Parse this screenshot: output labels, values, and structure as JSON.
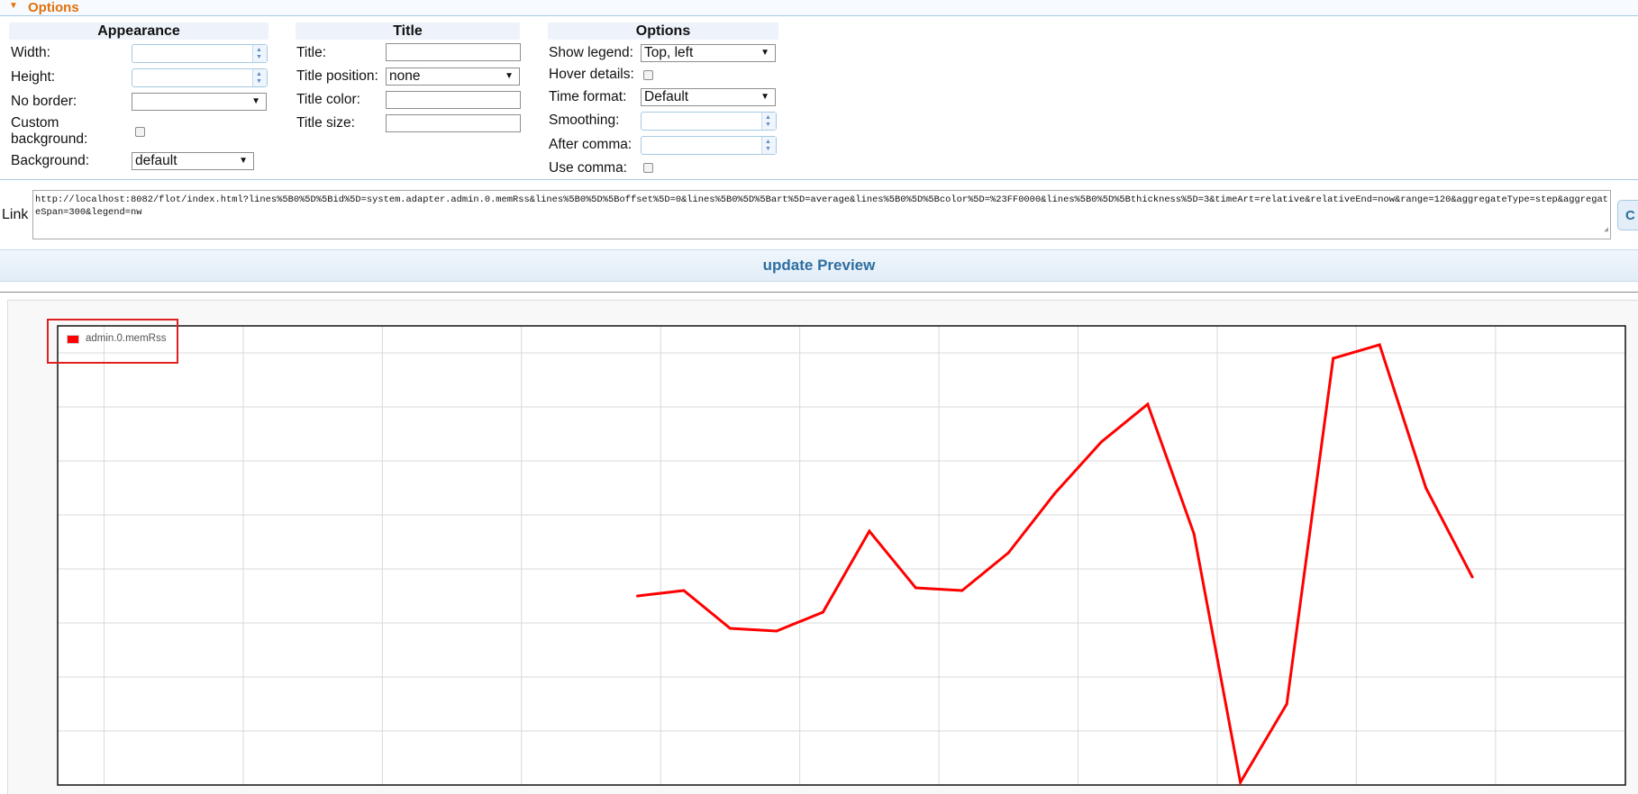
{
  "header": {
    "label": "Options"
  },
  "appearance": {
    "title": "Appearance",
    "width_label": "Width:",
    "height_label": "Height:",
    "no_border_label": "No border:",
    "custom_bg_label_1": "Custom",
    "custom_bg_label_2": "background:",
    "background_label": "Background:",
    "background_value": "default"
  },
  "title_group": {
    "title": "Title",
    "title_label": "Title:",
    "position_label": "Title position:",
    "position_value": "none",
    "color_label": "Title color:",
    "size_label": "Title size:"
  },
  "options_group": {
    "title": "Options",
    "legend_label": "Show legend:",
    "legend_value": "Top, left",
    "hover_label": "Hover details:",
    "time_format_label": "Time format:",
    "time_format_value": "Default",
    "smoothing_label": "Smoothing:",
    "after_comma_label": "After comma:",
    "use_comma_label": "Use comma:"
  },
  "link": {
    "label": "Link",
    "value": "http://localhost:8082/flot/index.html?lines%5B0%5D%5Bid%5D=system.adapter.admin.0.memRss&lines%5B0%5D%5Boffset%5D=0&lines%5B0%5D%5Bart%5D=average&lines%5B0%5D%5Bcolor%5D=%23FF0000&lines%5B0%5D%5Bthickness%5D=3&timeArt=relative&relativeEnd=now&range=120&aggregateType=step&aggregateSpan=300&legend=nw",
    "copy_label": "C"
  },
  "update_button": {
    "label": "update Preview"
  },
  "colors": {
    "accent": "#e17009",
    "line": "#ff0000",
    "highlight": "#e02020",
    "border": "#a6c9e2"
  },
  "chart_data": {
    "type": "line",
    "legend_position": "top-left",
    "grid": true,
    "series": [
      {
        "name": "admin.0.memRss",
        "color": "#ff0000",
        "x": [
          6.25,
          6.75,
          7.25,
          7.75,
          8.25,
          8.75,
          9.25,
          9.75,
          10.25,
          10.75,
          11.25,
          11.75,
          12.25,
          12.75,
          13.25,
          13.75,
          14.25,
          14.75,
          15.25
        ],
        "values": [
          0.5,
          0.52,
          0.38,
          0.37,
          0.44,
          0.74,
          0.53,
          0.52,
          0.66,
          0.88,
          1.07,
          1.21,
          0.73,
          -0.19,
          0.1,
          1.38,
          1.43,
          0.9,
          0.57
        ]
      }
    ]
  }
}
